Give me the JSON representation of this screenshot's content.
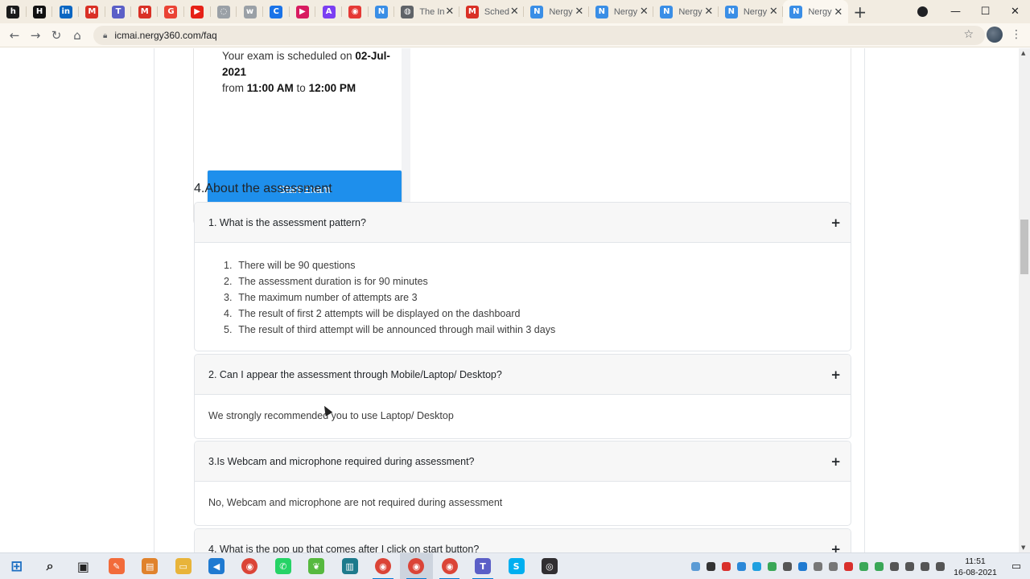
{
  "browser": {
    "pinned_tabs": [
      {
        "name": "hackerrank",
        "glyph": "h",
        "color": "#1a1a1a"
      },
      {
        "name": "hackerearth",
        "glyph": "H",
        "color": "#111111"
      },
      {
        "name": "linkedin",
        "glyph": "in",
        "color": "#0a66c2"
      },
      {
        "name": "gmail",
        "glyph": "M",
        "color": "#d93025"
      },
      {
        "name": "teams",
        "glyph": "T",
        "color": "#5b5fc7"
      },
      {
        "name": "gmail-2",
        "glyph": "M",
        "color": "#d93025"
      },
      {
        "name": "google",
        "glyph": "G",
        "color": "#ea4335"
      },
      {
        "name": "youtube",
        "glyph": "▶",
        "color": "#e62117"
      },
      {
        "name": "web",
        "glyph": "◌",
        "color": "#9aa0a6"
      },
      {
        "name": "w3schools",
        "glyph": "w",
        "color": "#9aa0a6"
      },
      {
        "name": "calendar",
        "glyph": "C",
        "color": "#1a73e8"
      },
      {
        "name": "media",
        "glyph": "▶",
        "color": "#d81b60"
      },
      {
        "name": "docs",
        "glyph": "A",
        "color": "#7b3ff2"
      },
      {
        "name": "ads",
        "glyph": "◉",
        "color": "#e53935"
      },
      {
        "name": "nergy",
        "glyph": "N",
        "color": "#3a8ee6"
      }
    ],
    "tabs": [
      {
        "title": "The In",
        "glyph": "◍",
        "color": "#5f6368",
        "active": false
      },
      {
        "title": "Sched",
        "glyph": "M",
        "color": "#d93025",
        "active": false
      },
      {
        "title": "Nergy",
        "glyph": "N",
        "color": "#3a8ee6",
        "active": false
      },
      {
        "title": "Nergy",
        "glyph": "N",
        "color": "#3a8ee6",
        "active": false
      },
      {
        "title": "Nergy",
        "glyph": "N",
        "color": "#3a8ee6",
        "active": false
      },
      {
        "title": "Nergy",
        "glyph": "N",
        "color": "#3a8ee6",
        "active": false
      },
      {
        "title": "Nergy",
        "glyph": "N",
        "color": "#3a8ee6",
        "active": true
      }
    ],
    "new_tab": "+",
    "url": "icmai.nergy360.com/faq"
  },
  "exam_card": {
    "line1_prefix": "Your exam is scheduled on ",
    "date": "02-Jul-2021",
    "from_label": "from ",
    "start_time": "11:00 AM",
    "to_label": " to ",
    "end_time": "12:00 PM",
    "button": "Start Exam"
  },
  "section": {
    "title": "4.About the assessment"
  },
  "faqs": [
    {
      "question": "1. What is the assessment pattern?",
      "toggle": "+",
      "answer_list": [
        "There will be 90 questions",
        "The assessment duration is for 90 minutes",
        "The maximum number of attempts are 3",
        "The result of first 2 attempts will be displayed on the dashboard",
        "The result of third attempt will be announced through mail within 3 days"
      ]
    },
    {
      "question": "2. Can I appear the assessment through Mobile/Laptop/ Desktop?",
      "toggle": "+",
      "answer": "We strongly recommended you to use Laptop/ Desktop"
    },
    {
      "question": "3.Is Webcam and microphone required during assessment?",
      "toggle": "+",
      "answer": "No, Webcam and microphone are not required during assessment"
    },
    {
      "question": "4. What is the pop up that comes after I click on start button?",
      "toggle": "+"
    }
  ],
  "taskbar": {
    "apps": [
      {
        "name": "windows-start",
        "glyph": "⊞",
        "color": "#1b6ec2",
        "running": false
      },
      {
        "name": "search",
        "glyph": "⌕",
        "color": "#333333",
        "running": false
      },
      {
        "name": "task-view",
        "glyph": "▣",
        "color": "#333333",
        "running": false
      },
      {
        "name": "postman",
        "glyph": "✎",
        "color": "#f26b3a",
        "running": false
      },
      {
        "name": "notepad",
        "glyph": "▤",
        "color": "#e0822b",
        "running": false
      },
      {
        "name": "file-explorer",
        "glyph": "▭",
        "color": "#e8b43a",
        "running": false
      },
      {
        "name": "vscode",
        "glyph": "◀",
        "color": "#1f7ad1",
        "running": false
      },
      {
        "name": "chrome",
        "glyph": "◉",
        "color": "#db4437",
        "running": false
      },
      {
        "name": "whatsapp",
        "glyph": "✆",
        "color": "#25d366",
        "running": false
      },
      {
        "name": "git",
        "glyph": "❦",
        "color": "#56b93f",
        "running": false
      },
      {
        "name": "jetbrains",
        "glyph": "▥",
        "color": "#1d7a8c",
        "running": false
      },
      {
        "name": "chrome-2",
        "glyph": "◉",
        "color": "#db4437",
        "running": true
      },
      {
        "name": "chrome-3",
        "glyph": "◉",
        "color": "#db4437",
        "running": true
      },
      {
        "name": "chrome-4",
        "glyph": "◉",
        "color": "#db4437",
        "running": true
      },
      {
        "name": "teams",
        "glyph": "T",
        "color": "#5b5fc7",
        "running": true
      },
      {
        "name": "skype",
        "glyph": "S",
        "color": "#00aff0",
        "running": false
      },
      {
        "name": "obs",
        "glyph": "◎",
        "color": "#302e31",
        "running": false
      }
    ],
    "tray_colors": [
      "#5b9bd5",
      "#333333",
      "#d9302c",
      "#2b88d8",
      "#1fa0e0",
      "#3aa757",
      "#555555",
      "#1f7ad1",
      "#777777",
      "#777777",
      "#d9302c",
      "#3aa757",
      "#3aa757",
      "#555555",
      "#555555",
      "#555555",
      "#555555"
    ],
    "time": "11:51",
    "date": "16-08-2021"
  }
}
